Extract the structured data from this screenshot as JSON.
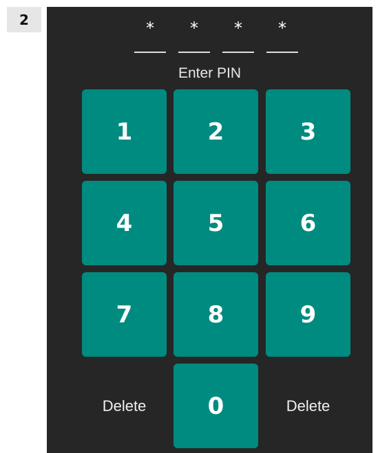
{
  "step_badge": "2",
  "pin": {
    "characters": [
      "*",
      "*",
      "*",
      "*"
    ],
    "label": "Enter PIN"
  },
  "keypad": {
    "keys": [
      "1",
      "2",
      "3",
      "4",
      "5",
      "6",
      "7",
      "8",
      "9",
      "0"
    ],
    "left_action": "Delete",
    "right_action": "Delete"
  },
  "colors": {
    "panel_background": "#262626",
    "key_background": "#008b80",
    "key_text": "#ffffff"
  }
}
